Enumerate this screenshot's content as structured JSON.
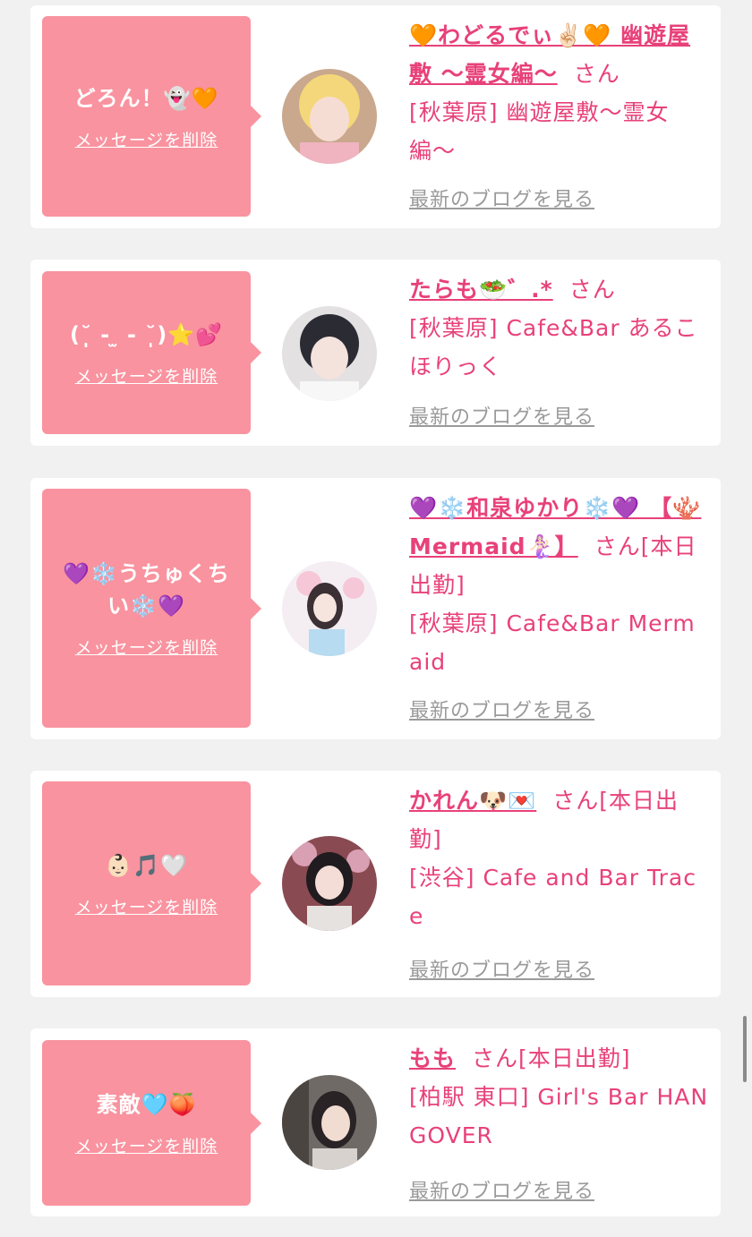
{
  "delete_label": "メッセージを削除",
  "blog_label": "最新のブログを見る",
  "honorific": "さん",
  "entries": [
    {
      "message": "どろん！👻🧡",
      "name": "🧡わどるでぃ✌🏻🧡 幽遊屋敷 〜霊女編〜",
      "status": "",
      "shop": "[秋葉原] 幽遊屋敷〜霊女編〜"
    },
    {
      "message": "(˘̩̩̩̩̩̩ ‐ ̫ ‐ ˘̩̩̩̩̩̩)⭐💕",
      "name": "たらも🥗゛.*",
      "status": "",
      "shop": "[秋葉原] Cafe&Bar あるこほりっく"
    },
    {
      "message": "💜❄️うちゅくちい❄️💜",
      "name": "💜❄️和泉ゆかり❄️💜 【🪸Mermaid🧜🏻‍♀️】",
      "status": "[本日出勤]",
      "shop": "[秋葉原] Cafe&Bar Mermaid"
    },
    {
      "message": "👶🏻🎵🤍",
      "name": "かれん🐶💌",
      "status": "[本日出勤]",
      "shop": "[渋谷] Cafe and Bar Trace"
    },
    {
      "message": "素敵🩵🍑",
      "name": "もも",
      "status": "[本日出勤]",
      "shop": "[柏駅 東口] Girl's Bar HANGOVER"
    }
  ]
}
